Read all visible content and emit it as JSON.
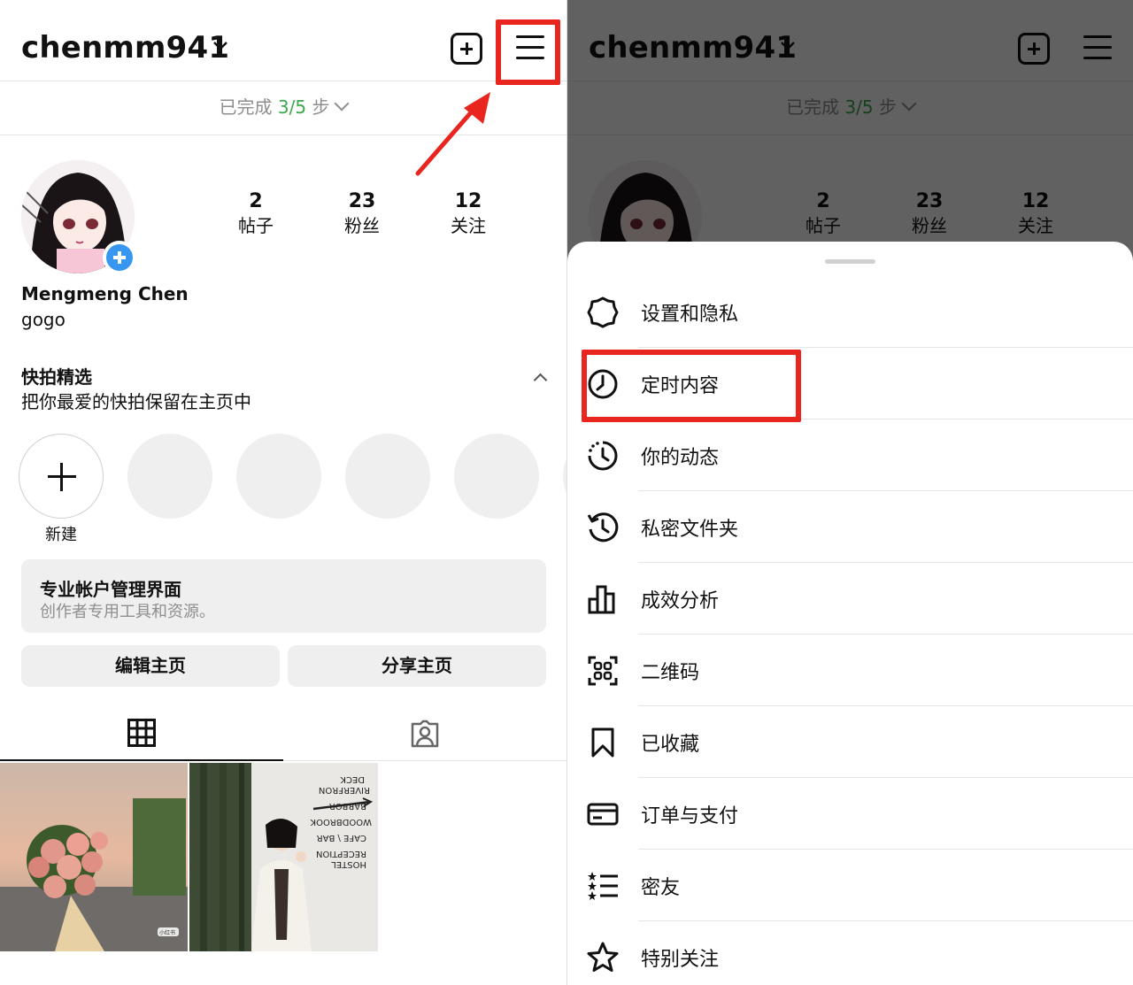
{
  "profile": {
    "username": "chenmm941",
    "progress_prefix": "已完成",
    "progress_value": "3/5",
    "progress_suffix": "步",
    "stats": [
      {
        "num": "2",
        "label": "帖子"
      },
      {
        "num": "23",
        "label": "粉丝"
      },
      {
        "num": "12",
        "label": "关注"
      }
    ],
    "full_name": "Mengmeng Chen",
    "bio": "gogo",
    "highlights_title": "快拍精选",
    "highlights_subtitle": "把你最爱的快拍保留在主页中",
    "new_label": "新建",
    "pro_dashboard_title": "专业帐户管理界面",
    "pro_dashboard_subtitle": "创作者专用工具和资源。",
    "edit_profile_label": "编辑主页",
    "share_profile_label": "分享主页",
    "post2_sign_lines": [
      "HOSTEL",
      "RECEPTION",
      "CAFE \\ BAR",
      "WOODBROOK",
      "BARBOR",
      "RIVERFRON",
      "DECK"
    ],
    "post1_badge": "小红书"
  },
  "menu": {
    "items": [
      {
        "label": "设置和隐私",
        "icon": "settings-gear-icon"
      },
      {
        "label": "定时内容",
        "icon": "clock-icon"
      },
      {
        "label": "你的动态",
        "icon": "activity-clock-icon"
      },
      {
        "label": "私密文件夹",
        "icon": "archive-history-icon"
      },
      {
        "label": "成效分析",
        "icon": "bar-chart-icon"
      },
      {
        "label": "二维码",
        "icon": "qr-code-icon"
      },
      {
        "label": "已收藏",
        "icon": "bookmark-icon"
      },
      {
        "label": "订单与支付",
        "icon": "credit-card-icon"
      },
      {
        "label": "密友",
        "icon": "close-friends-list-icon"
      },
      {
        "label": "特别关注",
        "icon": "star-icon"
      }
    ]
  },
  "colors": {
    "accent_blue": "#3797f0",
    "progress_green": "#3aa94b",
    "annotation_red": "#e8251f"
  }
}
